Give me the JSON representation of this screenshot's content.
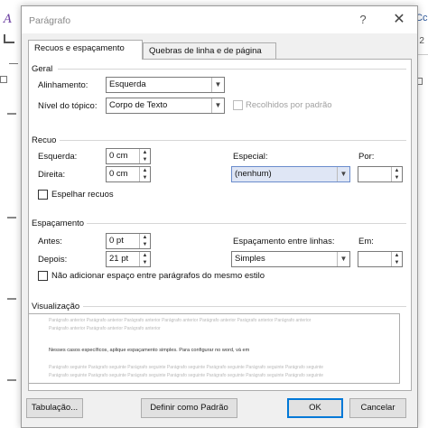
{
  "background": {
    "left_glyph": "A",
    "right_top": "oCc",
    "right_second": "o 2"
  },
  "dialog": {
    "title": "Parágrafo",
    "help": "?",
    "close": "✕"
  },
  "tabs": [
    {
      "label": "Recuos e espaçamento",
      "active": true
    },
    {
      "label": "Quebras de linha e de página",
      "active": false
    }
  ],
  "geral": {
    "heading": "Geral",
    "alinhamento_label": "Alinhamento:",
    "alinhamento_value": "Esquerda",
    "nivel_label": "Nível do tópico:",
    "nivel_value": "Corpo de Texto",
    "recolhidos_label": "Recolhidos por padrão"
  },
  "recuo": {
    "heading": "Recuo",
    "esquerda_label": "Esquerda:",
    "esquerda_value": "0 cm",
    "direita_label": "Direita:",
    "direita_value": "0 cm",
    "especial_label": "Especial:",
    "especial_value": "(nenhum)",
    "por_label": "Por:",
    "por_value": "",
    "espelhar_label": "Espelhar recuos"
  },
  "espacamento": {
    "heading": "Espaçamento",
    "antes_label": "Antes:",
    "antes_value": "0 pt",
    "depois_label": "Depois:",
    "depois_value": "21 pt",
    "entre_linhas_label": "Espaçamento entre linhas:",
    "entre_linhas_value": "Simples",
    "em_label": "Em:",
    "em_value": "",
    "nao_adicionar_label": "Não adicionar espaço entre parágrafos do mesmo estilo"
  },
  "visualizacao": {
    "heading": "Visualização",
    "prev_line": "Parágrafo anterior Parágrafo anterior Parágrafo anterior Parágrafo anterior Parágrafo anterior Parágrafo anterior Parágrafo anterior",
    "prev_line2": "Parágrafo anterior Parágrafo anterior Parágrafo anterior",
    "current": "Nesses casos específicos, aplique espaçamento simples. Para configurar no word, vá em",
    "next_line": "Parágrafo seguinte Parágrafo seguinte Parágrafo seguinte Parágrafo seguinte Parágrafo seguinte Parágrafo seguinte Parágrafo seguinte",
    "next_line2": "Parágrafo seguinte Parágrafo seguinte Parágrafo seguinte Parágrafo seguinte Parágrafo seguinte Parágrafo seguinte Parágrafo seguinte"
  },
  "buttons": {
    "tabulacao": "Tabulação...",
    "definir_padrao": "Definir como Padrão",
    "ok": "OK",
    "cancelar": "Cancelar"
  }
}
